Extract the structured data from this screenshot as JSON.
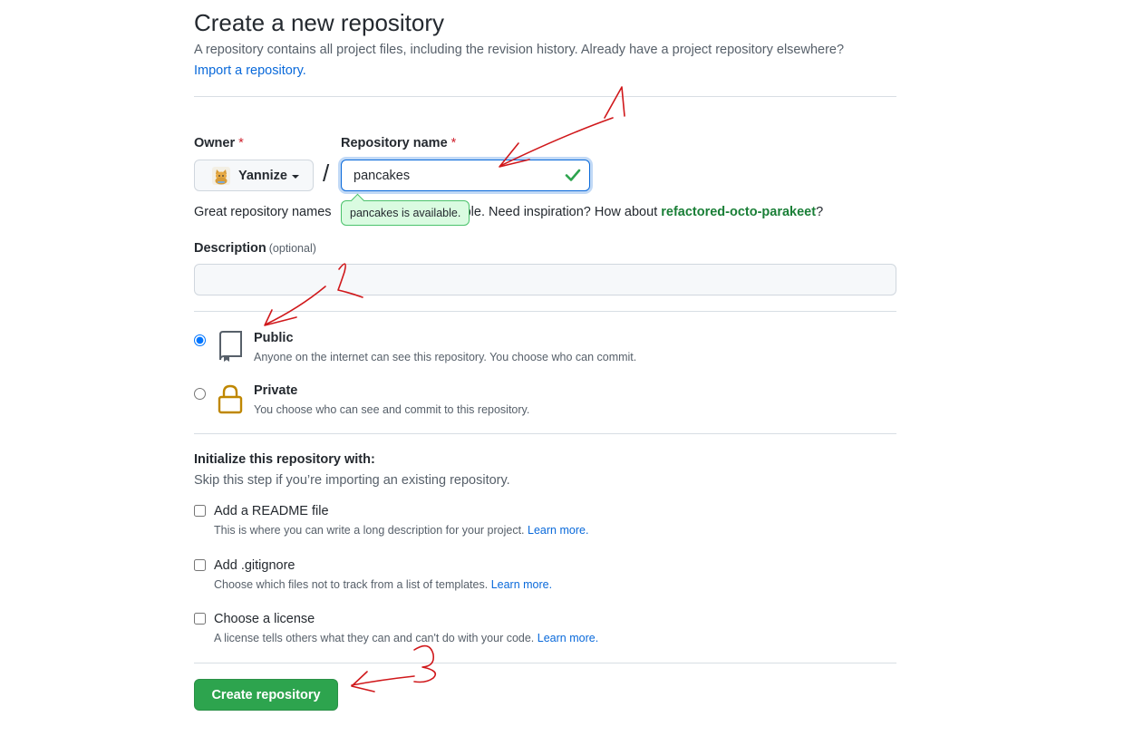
{
  "page": {
    "title": "Create a new repository",
    "intro": "A repository contains all project files, including the revision history. Already have a project repository elsewhere?",
    "import_link": "Import a repository."
  },
  "owner": {
    "label": "Owner",
    "required_mark": "*",
    "value": "Yannize",
    "avatar_icon": "cat-avatar-icon"
  },
  "repo_name": {
    "label": "Repository name",
    "required_mark": "*",
    "value": "pancakes",
    "status_icon": "check-icon",
    "tooltip": "pancakes is available.",
    "separator": "/"
  },
  "hint": {
    "prefix": "Great repository names",
    "middle": "able. Need inspiration? How about",
    "suggestion": "refactored-octo-parakeet",
    "suffix": "?"
  },
  "description": {
    "label": "Description",
    "optional": "(optional)",
    "value": ""
  },
  "visibility": {
    "selected": "public",
    "public": {
      "title": "Public",
      "subtitle": "Anyone on the internet can see this repository. You choose who can commit.",
      "icon": "repo-icon"
    },
    "private": {
      "title": "Private",
      "subtitle": "You choose who can see and commit to this repository.",
      "icon": "lock-icon"
    }
  },
  "initialize": {
    "title": "Initialize this repository with:",
    "subtitle": "Skip this step if you’re importing an existing repository.",
    "options": [
      {
        "title": "Add a README file",
        "subtitle": "This is where you can write a long description for your project.",
        "link": "Learn more.",
        "checked": false
      },
      {
        "title": "Add .gitignore",
        "subtitle": "Choose which files not to track from a list of templates.",
        "link": "Learn more.",
        "checked": false
      },
      {
        "title": "Choose a license",
        "subtitle": "A license tells others what they can and can't do with your code.",
        "link": "Learn more.",
        "checked": false
      }
    ]
  },
  "submit": {
    "label": "Create repository"
  },
  "colors": {
    "primary_button": "#2da44e",
    "link": "#0969da",
    "success": "#1a7f37",
    "annotation": "#d0181b",
    "lock": "#bf8700"
  }
}
